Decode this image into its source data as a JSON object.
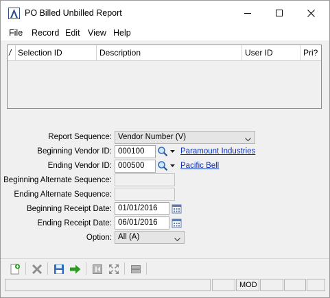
{
  "window": {
    "title": "PO Billed Unbilled Report"
  },
  "menu": {
    "file": "File",
    "record": "Record",
    "edit": "Edit",
    "view": "View",
    "help": "Help"
  },
  "grid": {
    "sort_indicator": "/",
    "columns": [
      "Selection ID",
      "Description",
      "User ID",
      "Pri?"
    ]
  },
  "form": {
    "report_sequence": {
      "label": "Report Sequence:",
      "value": "Vendor Number (V)"
    },
    "beginning_vendor": {
      "label": "Beginning Vendor ID:",
      "value": "000100",
      "name": "Paramount Industries"
    },
    "ending_vendor": {
      "label": "Ending Vendor ID:",
      "value": "000500",
      "name": "Pacific Bell"
    },
    "beginning_alt_seq": {
      "label": "Beginning Alternate Sequence:",
      "value": ""
    },
    "ending_alt_seq": {
      "label": "Ending Alternate Sequence:",
      "value": ""
    },
    "beginning_receipt_date": {
      "label": "Beginning Receipt Date:",
      "value": "01/01/2016"
    },
    "ending_receipt_date": {
      "label": "Ending Receipt Date:",
      "value": "06/01/2016"
    },
    "option": {
      "label": "Option:",
      "value": "All (A)"
    }
  },
  "toolbar": {
    "icons": [
      "new-record-icon",
      "delete-icon",
      "save-icon",
      "go-arrow-icon",
      "first-record-icon",
      "zoom-fit-icon",
      "minus-icon"
    ]
  },
  "status": {
    "mode": "MOD"
  },
  "colors": {
    "link": "#0a2fbf",
    "accent": "#2d4f8e",
    "go": "#2e9a24",
    "save": "#2d6cc0"
  }
}
